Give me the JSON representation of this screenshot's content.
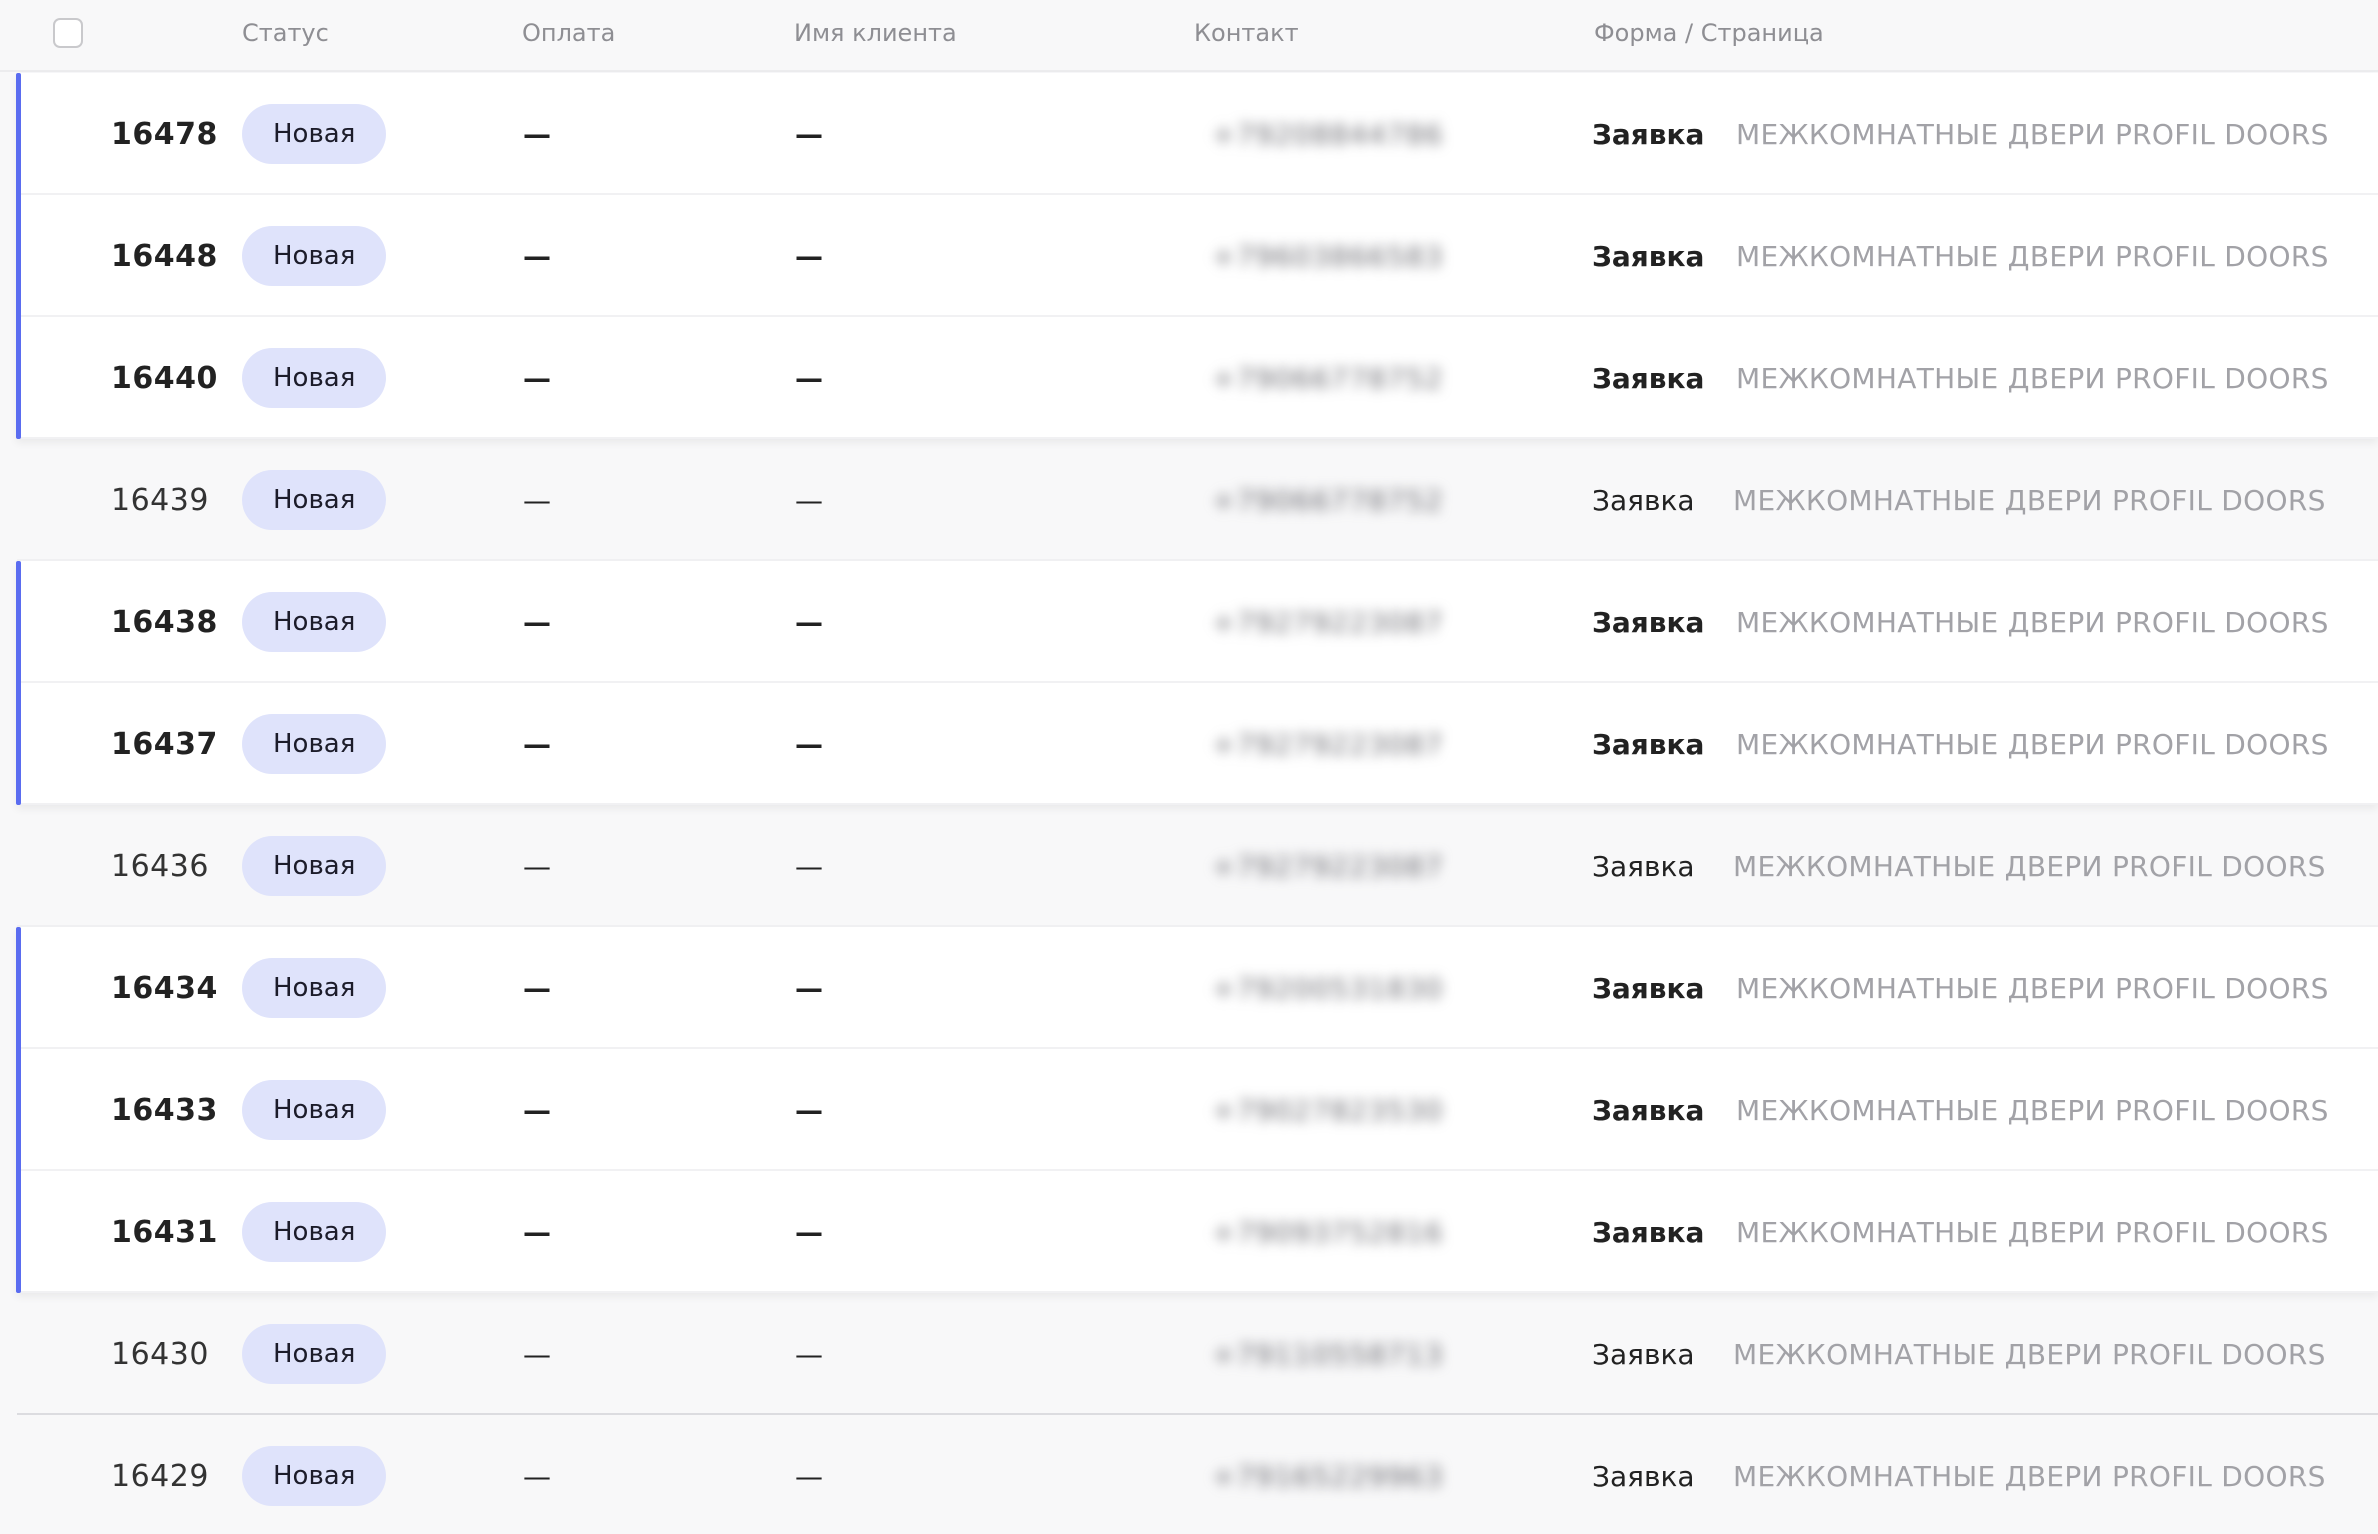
{
  "header": {
    "status": "Статус",
    "payment": "Оплата",
    "client_name": "Имя клиента",
    "contact": "Контакт",
    "form_page": "Форма / Страница"
  },
  "accent_color": "#5a6cf0",
  "badge_color": "#dfe3fb",
  "rows": [
    {
      "id": "16478",
      "status": "Новая",
      "payment": "—",
      "name": "—",
      "contact": "+79208844786",
      "form": "Заявка",
      "page": "МЕЖКОМНАТНЫЕ ДВЕРИ PROFIL DOORS",
      "unread": true
    },
    {
      "id": "16448",
      "status": "Новая",
      "payment": "—",
      "name": "—",
      "contact": "+79603866583",
      "form": "Заявка",
      "page": "МЕЖКОМНАТНЫЕ ДВЕРИ PROFIL DOORS",
      "unread": true
    },
    {
      "id": "16440",
      "status": "Новая",
      "payment": "—",
      "name": "—",
      "contact": "+79066778752",
      "form": "Заявка",
      "page": "МЕЖКОМНАТНЫЕ ДВЕРИ PROFIL DOORS",
      "unread": true
    },
    {
      "id": "16439",
      "status": "Новая",
      "payment": "—",
      "name": "—",
      "contact": "+79066778752",
      "form": "Заявка",
      "page": "МЕЖКОМНАТНЫЕ ДВЕРИ PROFIL DOORS",
      "unread": false
    },
    {
      "id": "16438",
      "status": "Новая",
      "payment": "—",
      "name": "—",
      "contact": "+79279223087",
      "form": "Заявка",
      "page": "МЕЖКОМНАТНЫЕ ДВЕРИ PROFIL DOORS",
      "unread": true
    },
    {
      "id": "16437",
      "status": "Новая",
      "payment": "—",
      "name": "—",
      "contact": "+79279223087",
      "form": "Заявка",
      "page": "МЕЖКОМНАТНЫЕ ДВЕРИ PROFIL DOORS",
      "unread": true
    },
    {
      "id": "16436",
      "status": "Новая",
      "payment": "—",
      "name": "—",
      "contact": "+79279223087",
      "form": "Заявка",
      "page": "МЕЖКОМНАТНЫЕ ДВЕРИ PROFIL DOORS",
      "unread": false
    },
    {
      "id": "16434",
      "status": "Новая",
      "payment": "—",
      "name": "—",
      "contact": "+79200531830",
      "form": "Заявка",
      "page": "МЕЖКОМНАТНЫЕ ДВЕРИ PROFIL DOORS",
      "unread": true
    },
    {
      "id": "16433",
      "status": "Новая",
      "payment": "—",
      "name": "—",
      "contact": "+79027823530",
      "form": "Заявка",
      "page": "МЕЖКОМНАТНЫЕ ДВЕРИ PROFIL DOORS",
      "unread": true
    },
    {
      "id": "16431",
      "status": "Новая",
      "payment": "—",
      "name": "—",
      "contact": "+79093752816",
      "form": "Заявка",
      "page": "МЕЖКОМНАТНЫЕ ДВЕРИ PROFIL DOORS",
      "unread": true
    },
    {
      "id": "16430",
      "status": "Новая",
      "payment": "—",
      "name": "—",
      "contact": "+79110558713",
      "form": "Заявка",
      "page": "МЕЖКОМНАТНЫЕ ДВЕРИ PROFIL DOORS",
      "unread": false
    },
    {
      "id": "16429",
      "status": "Новая",
      "payment": "—",
      "name": "—",
      "contact": "+79165229963",
      "form": "Заявка",
      "page": "МЕЖКОМНАТНЫЕ ДВЕРИ PROFIL DOORS",
      "unread": false
    }
  ]
}
